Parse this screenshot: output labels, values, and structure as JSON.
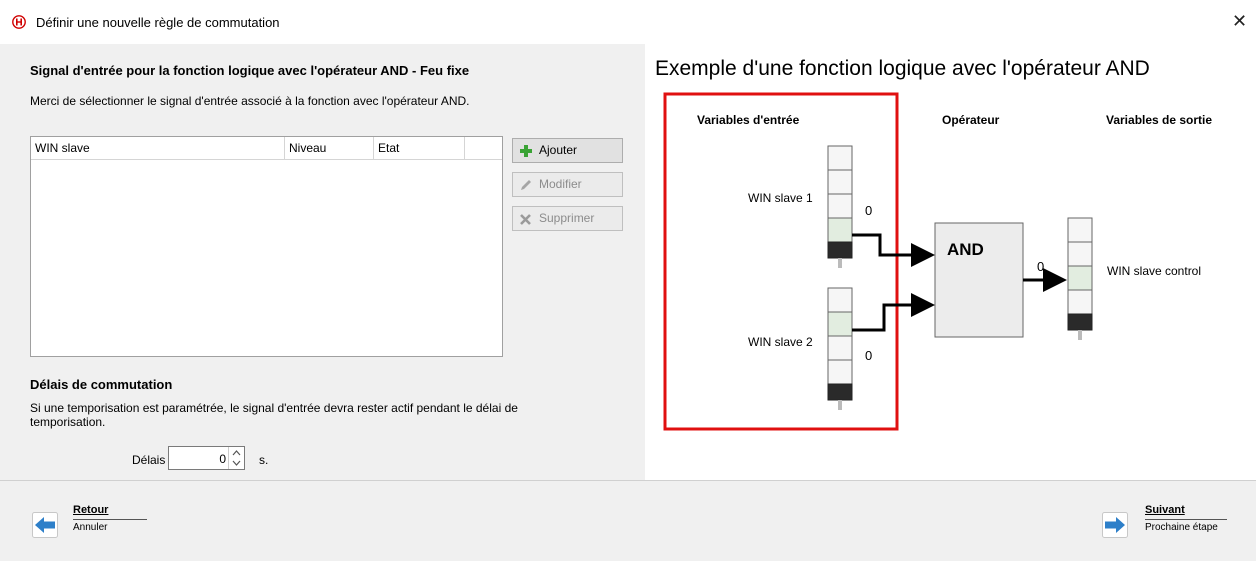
{
  "window": {
    "title": "Définir une nouvelle règle de commutation",
    "close_symbol": "✕"
  },
  "left": {
    "heading": "Signal d'entrée pour la fonction logique avec l'opérateur AND - Feu fixe",
    "instruction": "Merci de sélectionner le signal d'entrée associé à la fonction avec l'opérateur AND.",
    "table": {
      "columns": [
        "WIN slave",
        "Niveau",
        "Etat",
        ""
      ],
      "rows": []
    },
    "buttons": {
      "add": "Ajouter",
      "modify": "Modifier",
      "delete": "Supprimer"
    },
    "delay_heading": "Délais de commutation",
    "delay_text": "Si une temporisation est paramétrée, le signal d'entrée devra rester actif pendant le délai de temporisation.",
    "delay_label": "Délais",
    "delay_value": "0",
    "delay_unit": "s."
  },
  "example": {
    "title": "Exemple d'une fonction logique avec l'opérateur AND",
    "header_inputs": "Variables d'entrée",
    "header_operator": "Opérateur",
    "header_outputs": "Variables de sortie",
    "input1_label": "WIN slave 1",
    "input1_value": "0",
    "input2_label": "WIN slave 2",
    "input2_value": "0",
    "operator_label": "AND",
    "output_value": "0",
    "output_label": "WIN slave control",
    "highlight_color": "#e01010"
  },
  "footer": {
    "back_label": "Retour",
    "back_sub": "Annuler",
    "next_label": "Suivant",
    "next_sub": "Prochaine étape"
  },
  "icons": [
    "app-logo-icon",
    "close-icon",
    "plus-icon",
    "pencil-icon",
    "delete-icon",
    "back-arrow-icon",
    "next-arrow-icon"
  ]
}
